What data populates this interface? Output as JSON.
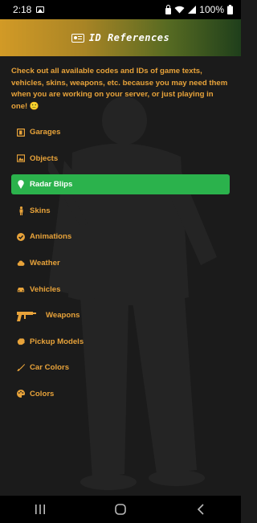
{
  "status_bar": {
    "time": "2:18",
    "battery": "100%"
  },
  "header": {
    "title": "ID References",
    "icon": "id-card-icon"
  },
  "intro_text": "Check out all available codes and IDs of game texts, vehicles, skins, weapons, etc. because you may need them when you are working on your server, or just playing in one! 🙂",
  "menu": {
    "items": [
      {
        "label": "Garages",
        "icon": "garage-icon"
      },
      {
        "label": "Objects",
        "icon": "object-icon"
      },
      {
        "label": "Radar Blips",
        "icon": "map-pin-icon",
        "active": true
      },
      {
        "label": "Skins",
        "icon": "person-icon"
      },
      {
        "label": "Animations",
        "icon": "check-circle-icon"
      },
      {
        "label": "Weather",
        "icon": "cloud-icon"
      },
      {
        "label": "Vehicles",
        "icon": "car-icon"
      },
      {
        "label": "Weapons",
        "icon": "gun-icon"
      },
      {
        "label": "Pickup Models",
        "icon": "hand-icon"
      },
      {
        "label": "Car Colors",
        "icon": "brush-icon"
      },
      {
        "label": "Colors",
        "icon": "palette-icon"
      }
    ]
  },
  "colors": {
    "accent": "#e8a33a",
    "active_bg": "#2bb24c",
    "background": "#1b1b1b"
  }
}
